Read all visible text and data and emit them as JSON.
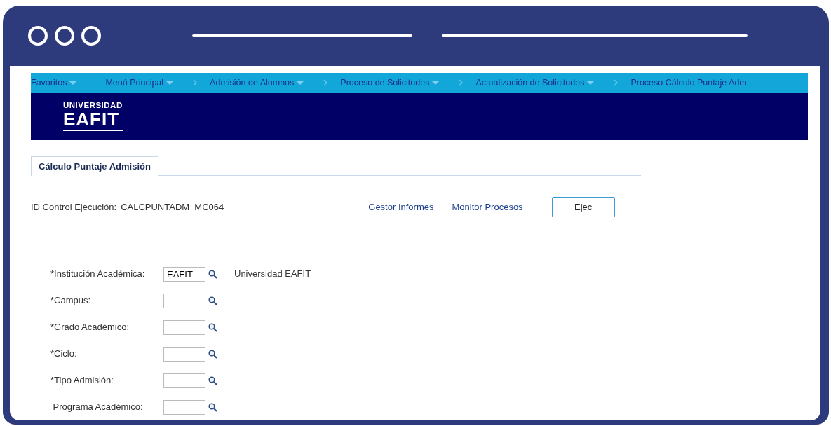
{
  "menu_bar": [
    {
      "label": "Favoritos",
      "has_menu": true,
      "kind": "root"
    },
    {
      "label": "Menú Principal",
      "has_menu": true,
      "kind": "root"
    },
    {
      "label": "Admisión de Alumnos",
      "has_menu": true,
      "kind": "path"
    },
    {
      "label": "Proceso de Solicitudes",
      "has_menu": true,
      "kind": "path"
    },
    {
      "label": "Actualización de Solicitudes",
      "has_menu": true,
      "kind": "path"
    },
    {
      "label": "Proceso Cálculo Puntaje Adm",
      "has_menu": false,
      "kind": "path"
    }
  ],
  "banner": {
    "logo_top": "UNIVERSIDAD",
    "logo_main": "EAFIT"
  },
  "tabs": [
    {
      "label": "Cálculo Puntaje Admisión",
      "selected": true
    }
  ],
  "run_control": {
    "label": "ID Control Ejecución:",
    "value": "CALCPUNTADM_MC064",
    "links": [
      "Gestor Informes",
      "Monitor Procesos"
    ],
    "button": "Ejec"
  },
  "fields": [
    {
      "label": "*Institución Académica:",
      "value": "EAFIT",
      "description": "Universidad EAFIT"
    },
    {
      "label": "*Campus:"
    },
    {
      "label": "*Grado Académico:"
    },
    {
      "label": "*Ciclo:"
    },
    {
      "label": "*Tipo Admisión:"
    },
    {
      "label": " Programa Académico:"
    }
  ]
}
